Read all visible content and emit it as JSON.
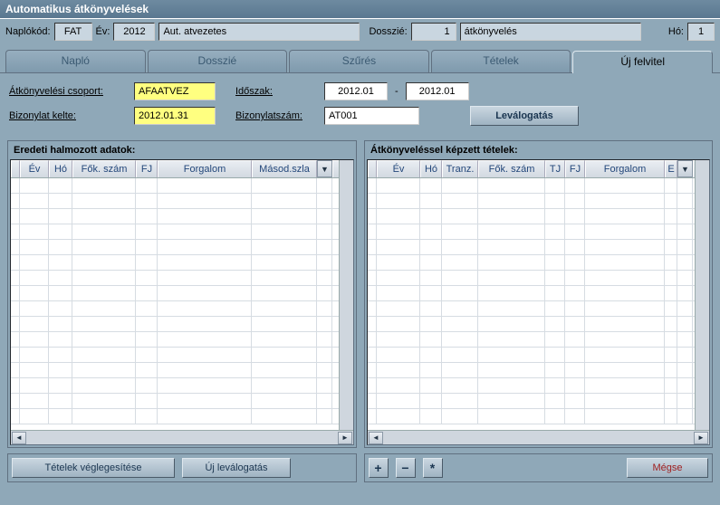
{
  "window": {
    "title": "Automatikus átkönyvelések"
  },
  "header": {
    "naploLabel": "Naplókód:",
    "naploCode": "FAT",
    "yearLabel": "Év:",
    "year": "2012",
    "desc": "Aut. atvezetes",
    "dosszieLabel": "Dosszié:",
    "dosszieNum": "1",
    "dosszieType": "átkönyvelés",
    "hoLabel": "Hó:",
    "ho": "1"
  },
  "tabs": [
    "Napló",
    "Dosszié",
    "Szűrés",
    "Tételek",
    "Új felvitel"
  ],
  "form": {
    "groupLabel": "Átkönyvelési csoport:",
    "group": "AFAATVEZ",
    "periodLabel": "Időszak:",
    "periodFrom": "2012.01",
    "periodTo": "2012.01",
    "dateLabel": "Bizonylat kelte:",
    "date": "2012.01.31",
    "docnumLabel": "Bizonylatszám:",
    "docnum": "AT001",
    "selectBtn": "Leválogatás"
  },
  "gridLeft": {
    "title": "Eredeti halmozott adatok:",
    "cols": [
      "Év",
      "Hó",
      "Fők. szám",
      "FJ",
      "Forgalom",
      "Másod.szla"
    ]
  },
  "gridRight": {
    "title": "Átkönyveléssel képzett tételek:",
    "cols": [
      "Év",
      "Hó",
      "Tranz.",
      "Fők. szám",
      "TJ",
      "FJ",
      "Forgalom",
      "E"
    ]
  },
  "footer": {
    "finalizeBtn": "Tételek véglegesítése",
    "newSelectBtn": "Új leválogatás",
    "plus": "+",
    "minus": "−",
    "star": "*",
    "cancel": "Mégse"
  }
}
